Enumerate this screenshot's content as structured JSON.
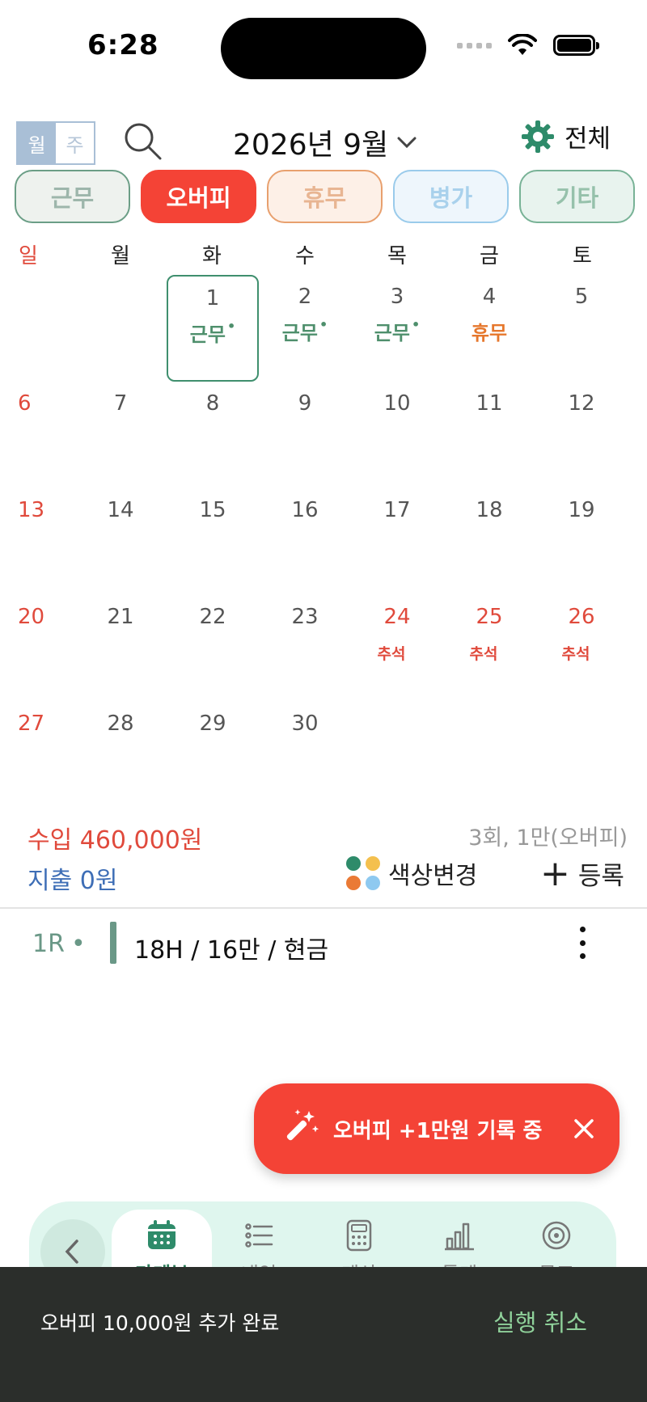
{
  "status": {
    "time": "6:28"
  },
  "header": {
    "view_month": "월",
    "view_week": "주",
    "month_title": "2026년 9월",
    "settings_label": "전체"
  },
  "categories": [
    {
      "label": "근무",
      "key": "work"
    },
    {
      "label": "오버피",
      "key": "over"
    },
    {
      "label": "휴무",
      "key": "off"
    },
    {
      "label": "병가",
      "key": "sick"
    },
    {
      "label": "기타",
      "key": "etc"
    }
  ],
  "weekdays": [
    "일",
    "월",
    "화",
    "수",
    "목",
    "금",
    "토"
  ],
  "calendar": {
    "weeks": [
      [
        {
          "d": ""
        },
        {
          "d": ""
        },
        {
          "d": "1",
          "tag": "근무",
          "type": "work",
          "today": true
        },
        {
          "d": "2",
          "tag": "근무",
          "type": "work"
        },
        {
          "d": "3",
          "tag": "근무",
          "type": "work"
        },
        {
          "d": "4",
          "tag": "휴무",
          "type": "vac"
        },
        {
          "d": "5"
        }
      ],
      [
        {
          "d": "6"
        },
        {
          "d": "7"
        },
        {
          "d": "8"
        },
        {
          "d": "9"
        },
        {
          "d": "10"
        },
        {
          "d": "11"
        },
        {
          "d": "12"
        }
      ],
      [
        {
          "d": "13"
        },
        {
          "d": "14"
        },
        {
          "d": "15"
        },
        {
          "d": "16"
        },
        {
          "d": "17"
        },
        {
          "d": "18"
        },
        {
          "d": "19"
        }
      ],
      [
        {
          "d": "20"
        },
        {
          "d": "21"
        },
        {
          "d": "22"
        },
        {
          "d": "23"
        },
        {
          "d": "24",
          "hol": "추석"
        },
        {
          "d": "25",
          "hol": "추석"
        },
        {
          "d": "26",
          "hol": "추석"
        }
      ],
      [
        {
          "d": "27"
        },
        {
          "d": "28"
        },
        {
          "d": "29"
        },
        {
          "d": "30"
        },
        {
          "d": ""
        },
        {
          "d": ""
        },
        {
          "d": ""
        }
      ]
    ]
  },
  "summary": {
    "income": "수입 460,000원",
    "expense": "지출 0원",
    "count": "3회, 1만(오버피)",
    "color_change": "색상변경",
    "add": "등록",
    "dot_colors": [
      "#2e8b6a",
      "#f4c04e",
      "#ea7a35",
      "#8ec9f0"
    ]
  },
  "record": {
    "round": "1R",
    "detail": "18H / 16만 / 현금"
  },
  "banner": {
    "message": "오버피 +1만원 기록 중"
  },
  "nav": {
    "items": [
      {
        "label": "가계부",
        "icon": "calendar-icon"
      },
      {
        "label": "내역",
        "icon": "list-icon"
      },
      {
        "label": "계산",
        "icon": "calculator-icon"
      },
      {
        "label": "통계",
        "icon": "bar-chart-icon"
      },
      {
        "label": "목표",
        "icon": "target-icon"
      }
    ]
  },
  "snackbar": {
    "message": "오버피 10,000원 추가 완료",
    "action": "실행 취소"
  },
  "colors": {
    "accent_red": "#f44336",
    "accent_green": "#2e7d5b",
    "sunday_red": "#e04a3c"
  }
}
